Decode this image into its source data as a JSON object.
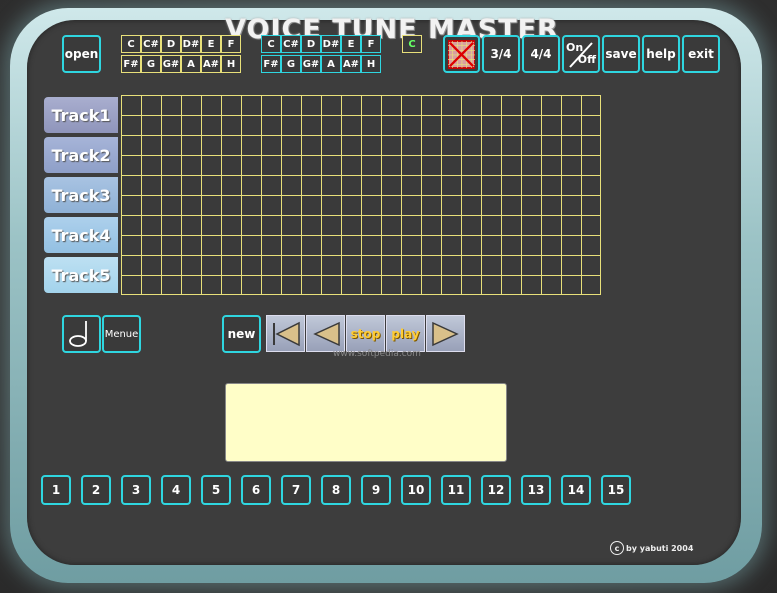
{
  "app": {
    "title": "VOICE TUNE MASTER"
  },
  "toolbar": {
    "open": "open",
    "time_3_4": "3/4",
    "time_4_4": "4/4",
    "on": "On",
    "off": "Off",
    "save": "save",
    "help": "help",
    "exit": "exit"
  },
  "notes_left": {
    "row1": [
      "C",
      "C#",
      "D",
      "D#",
      "E",
      "F"
    ],
    "row2": [
      "F#",
      "G",
      "G#",
      "A",
      "A#",
      "H"
    ]
  },
  "notes_right": {
    "row1": [
      "C",
      "C#",
      "D",
      "D#",
      "E",
      "F"
    ],
    "row2": [
      "F#",
      "G",
      "G#",
      "A",
      "A#",
      "H"
    ]
  },
  "current_note": "C",
  "tracks": [
    "Track1",
    "Track2",
    "Track3",
    "Track4",
    "Track5"
  ],
  "controls": {
    "menue": "Menue",
    "new": "new",
    "stop": "stop",
    "play": "play"
  },
  "watermark": "www.softpedia.com",
  "numbers": [
    "1",
    "2",
    "3",
    "4",
    "5",
    "6",
    "7",
    "8",
    "9",
    "10",
    "11",
    "12",
    "13",
    "14",
    "15"
  ],
  "copyright": {
    "symbol": "c",
    "text": "by yabuti 2004"
  },
  "colors": {
    "accent": "#2fd6e0",
    "grid": "#e8e07a",
    "display": "#fffec8"
  }
}
